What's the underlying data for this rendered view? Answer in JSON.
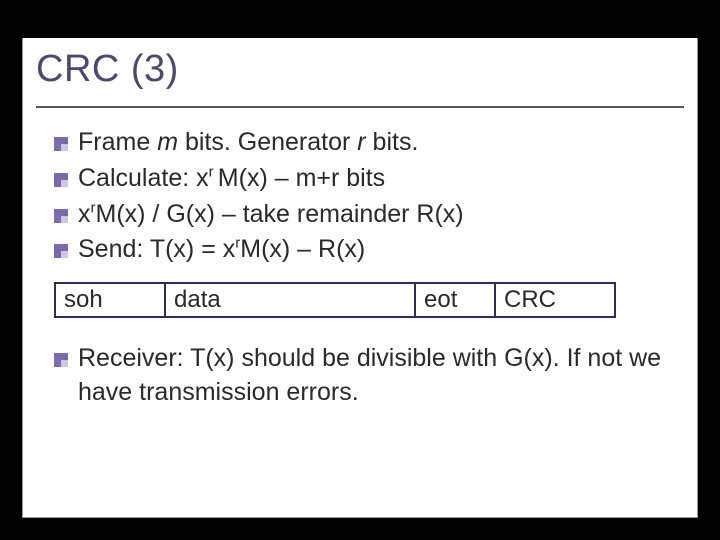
{
  "title": "CRC (3)",
  "bullets": {
    "b1_pre": "Frame ",
    "b1_m": "m",
    "b1_mid": " bits.   Generator ",
    "b1_r": "r",
    "b1_post": " bits.",
    "b2_pre": "Calculate:  x",
    "b2_sup": "r ",
    "b2_post": "M(x) – m+r bits",
    "b3_pre": " x",
    "b3_sup": "r",
    "b3_post": "M(x) / G(x) – take remainder R(x)",
    "b4_pre": "Send: T(x) = x",
    "b4_sup": "r",
    "b4_post": "M(x) – R(x)"
  },
  "frame": {
    "soh": "soh",
    "data": "data",
    "eot": "eot",
    "crc": "CRC"
  },
  "receiver": "Receiver: T(x) should be divisible with G(x). If not we have transmission errors."
}
